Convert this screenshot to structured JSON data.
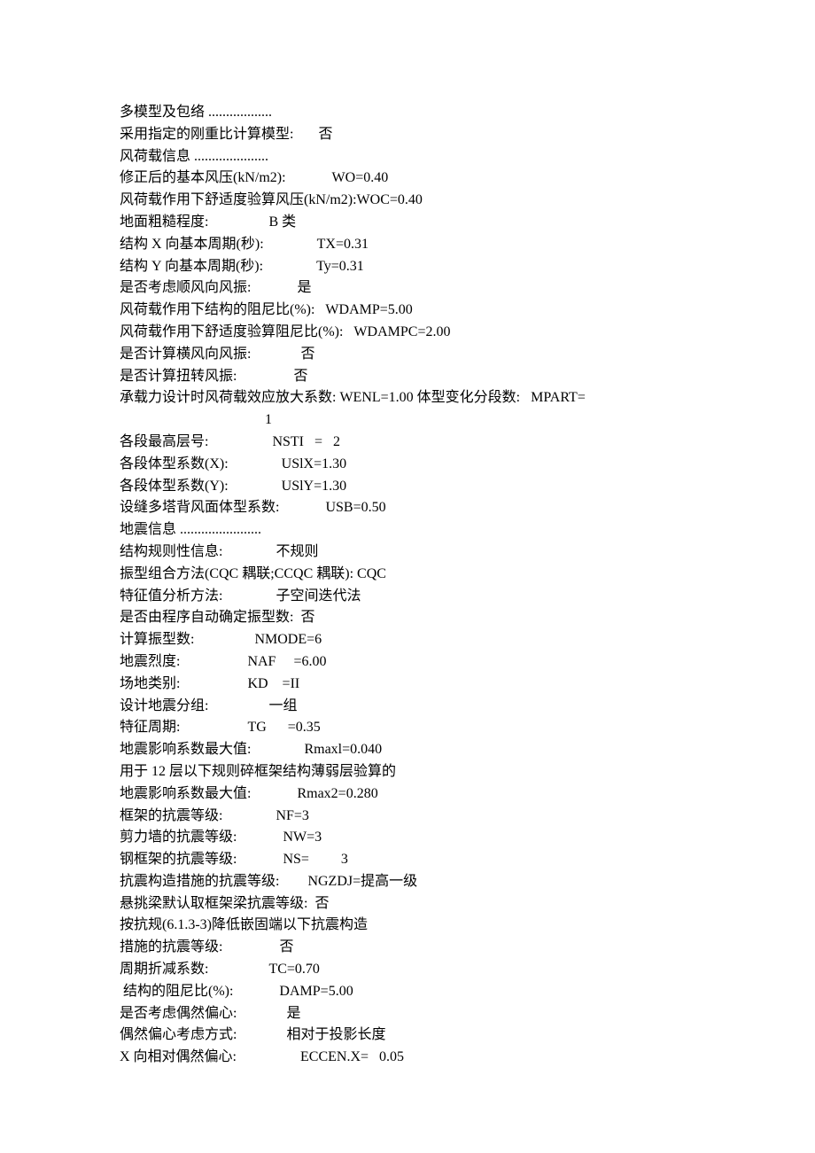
{
  "lines": [
    "多模型及包络 ..................",
    "采用指定的刚重比计算模型:       否",
    "",
    "风荷载信息 .....................",
    "修正后的基本风压(kN/m2):             WO=0.40",
    "风荷载作用下舒适度验算风压(kN/m2):WOC=0.40",
    "地面粗糙程度:                 B 类",
    "结构 X 向基本周期(秒):               TX=0.31",
    "结构 Y 向基本周期(秒):               Ty=0.31",
    "是否考虑顺风向风振:             是",
    "风荷载作用下结构的阻尼比(%):   WDAMP=5.00",
    "风荷载作用下舒适度验算阻尼比(%):   WDAMPC=2.00",
    "是否计算横风向风振:              否",
    "是否计算扭转风振:                否",
    "承载力设计时风荷载效应放大系数: WENL=1.00 体型变化分段数:   MPART=",
    "                                         1",
    "各段最高层号:                  NSTI   =   2",
    "各段体型系数(X):               USlX=1.30",
    "各段体型系数(Y):               USlY=1.30",
    "设缝多塔背风面体型系数:             USB=0.50",
    "",
    "地震信息 .......................",
    "结构规则性信息:               不规则",
    "振型组合方法(CQC 耦联;CCQC 耦联): CQC",
    "特征值分析方法:               子空间迭代法",
    "是否由程序自动确定振型数:  否",
    "计算振型数:                 NMODE=6",
    "地震烈度:                   NAF     =6.00",
    "场地类别:                   KD    =II",
    "设计地震分组:                 一组",
    "特征周期:                   TG      =0.35",
    "地震影响系数最大值:               Rmaxl=0.040",
    "用于 12 层以下规则碎框架结构薄弱层验算的",
    "地震影响系数最大值:             Rmax2=0.280",
    "框架的抗震等级:               NF=3",
    "剪力墙的抗震等级:             NW=3",
    "钢框架的抗震等级:             NS=         3",
    "抗震构造措施的抗震等级:        NGZDJ=提高一级",
    "悬挑梁默认取框架梁抗震等级:  否",
    "按抗规(6.1.3-3)降低嵌固端以下抗震构造",
    "措施的抗震等级:                否",
    "周期折减系数:                 TC=0.70",
    " 结构的阻尼比(%):             DAMP=5.00",
    "是否考虑偶然偏心:              是",
    "偶然偏心考虑方式:              相对于投影长度",
    "X 向相对偶然偏心:                  ECCEN.X=   0.05"
  ]
}
